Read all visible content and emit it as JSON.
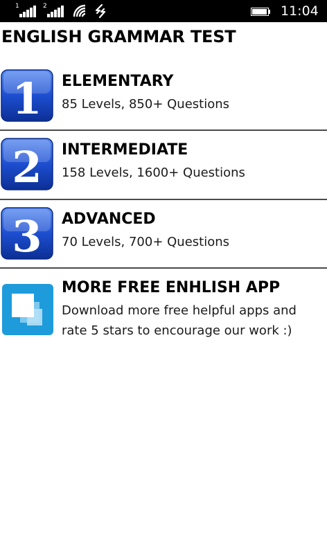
{
  "status_bar": {
    "sim1_label": "1",
    "sim2_label": "2",
    "time": "11:04",
    "icons": [
      "signal-icon",
      "signal-icon",
      "wifi-icon",
      "data-icon",
      "battery-icon"
    ]
  },
  "page": {
    "title": "ENGLISH GRAMMAR TEST"
  },
  "items": [
    {
      "badge": "1",
      "title": "ELEMENTARY",
      "subtitle": "85 Levels, 850+ Questions"
    },
    {
      "badge": "2",
      "title": "INTERMEDIATE",
      "subtitle": "158 Levels, 1600+ Questions"
    },
    {
      "badge": "3",
      "title": "ADVANCED",
      "subtitle": "70 Levels, 700+ Questions"
    },
    {
      "title": "MORE FREE ENHLISH APP",
      "subtitle_line1": "Download more free helpful apps and",
      "subtitle_line2": "rate 5 stars to encourage our work :)"
    }
  ],
  "colors": {
    "status_bar_bg": "#000000",
    "badge_blue": "#1a4fc9",
    "store_tile_blue": "#1e9bdb",
    "divider": "#4a4a4a"
  }
}
